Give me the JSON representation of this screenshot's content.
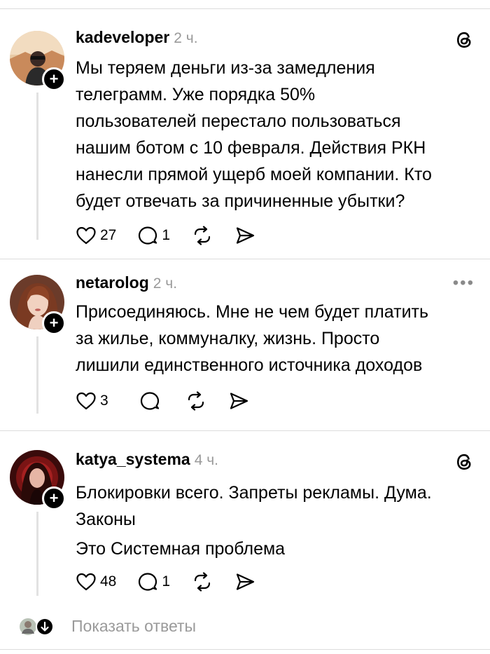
{
  "posts": [
    {
      "username": "kadeveloper",
      "time": "2 ч.",
      "lines": [
        "Мы теряем деньги из-за замедления",
        "телеграмм. Уже порядка 50%",
        "пользователей перестало пользоваться",
        "нашим ботом с 10 февраля. Действия РКН",
        "нанесли прямой ущерб моей компании. Кто",
        "будет отвечать за причиненные убытки?"
      ],
      "likes": "27",
      "replies": "1",
      "menu_icon": "threads-logo-icon"
    },
    {
      "username": "netarolog",
      "time": "2 ч.",
      "lines": [
        "Присоединяюсь. Мне не чем будет платить",
        "за жилье, коммуналку, жизнь. Просто",
        "лишили единственного источника доходов"
      ],
      "likes": "3",
      "replies": "",
      "more_label": "•••"
    },
    {
      "username": "katya_systema",
      "time": "4 ч.",
      "lines": [
        "Блокировки всего. Запреты рекламы. Дума.",
        "Законы",
        "Это Системная проблема"
      ],
      "likes": "48",
      "replies": "1",
      "menu_icon": "threads-logo-icon"
    }
  ],
  "show_replies": {
    "label": "Показать ответы"
  },
  "colors": {
    "muted": "#9a9a9a",
    "divider": "#dcdcdc",
    "text": "#000000"
  }
}
